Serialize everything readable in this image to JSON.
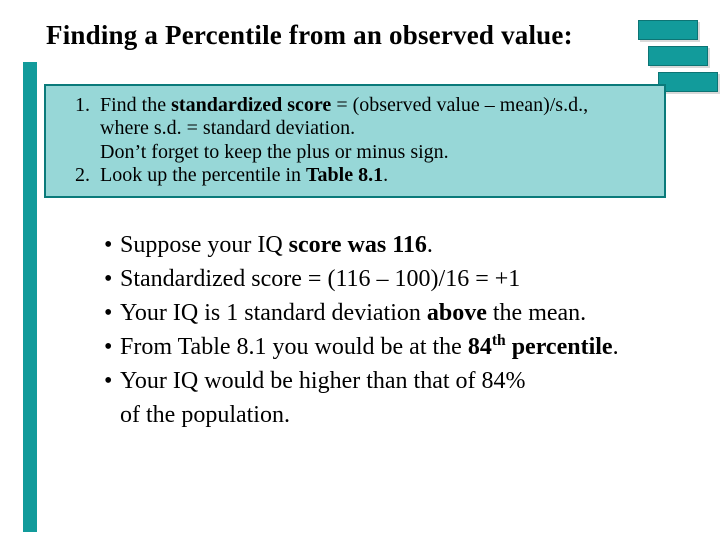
{
  "title": "Finding a Percentile from an observed value:",
  "steps": [
    {
      "num": "1.",
      "line1_a": "Find the ",
      "line1_b": "standardized score",
      "line1_c": " = (observed value – mean)/s.d.,",
      "line2": "where s.d. = standard deviation.",
      "line3": "Don’t forget to keep the plus or minus sign."
    },
    {
      "num": "2.",
      "line1_a": "Look up the percentile in ",
      "line1_b": "Table 8.1",
      "line1_c": "."
    }
  ],
  "bullets": [
    {
      "a": "Suppose your IQ ",
      "b": "score was 116",
      "c": "."
    },
    {
      "a": "Standardized score = (116 – 100)/16 = +1",
      "b": "",
      "c": ""
    },
    {
      "a": "Your IQ is 1 standard deviation ",
      "b": "above",
      "c": " the mean."
    },
    {
      "a": "From Table 8.1 you would be at the ",
      "b": "84",
      "sup": "th",
      "b2": " percentile",
      "c": "."
    },
    {
      "a": "Your IQ would be higher than that of 84%",
      "cont": "of the population."
    }
  ]
}
